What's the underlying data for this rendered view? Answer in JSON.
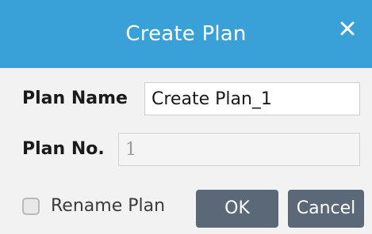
{
  "dialog": {
    "title": "Create Plan",
    "close_icon": "close-icon"
  },
  "form": {
    "plan_name_label": "Plan Name",
    "plan_name_value": "Create Plan_1",
    "plan_no_label": "Plan No.",
    "plan_no_value": "1",
    "rename_label": "Rename Plan",
    "rename_checked": false
  },
  "buttons": {
    "ok_label": "OK",
    "cancel_label": "Cancel"
  },
  "colors": {
    "titlebar": "#3aa0d8",
    "button": "#5b6877",
    "background": "#f2f2f2"
  }
}
